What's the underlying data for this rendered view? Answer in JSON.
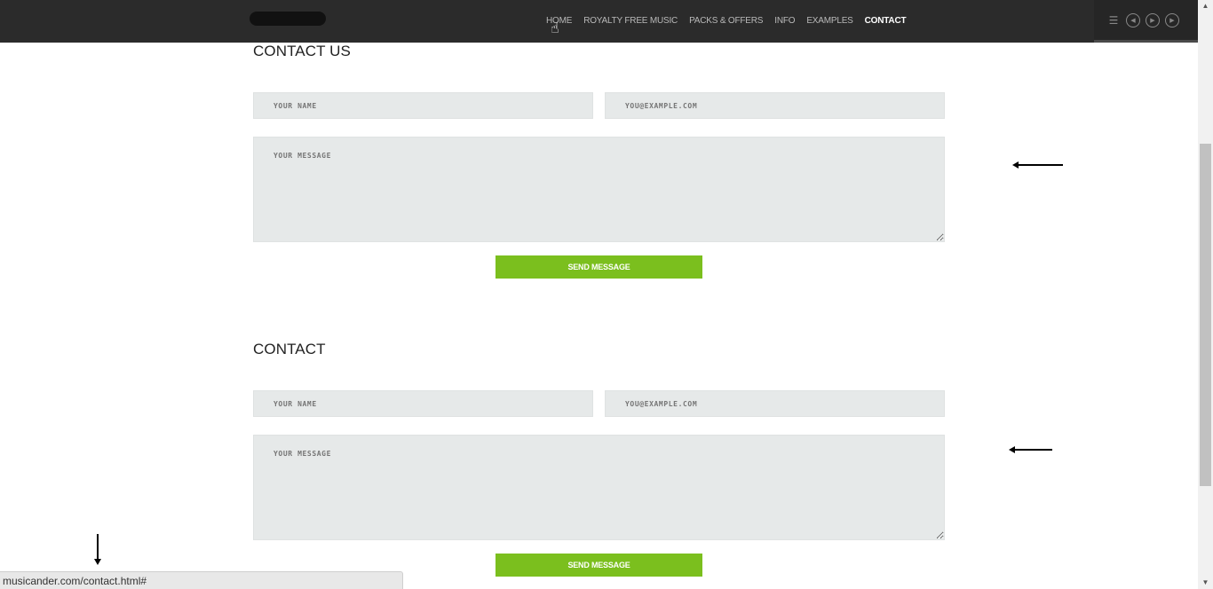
{
  "nav": {
    "items": [
      {
        "label": "HOME",
        "active": false
      },
      {
        "label": "ROYALTY FREE MUSIC",
        "active": false
      },
      {
        "label": "PACKS & OFFERS",
        "active": false
      },
      {
        "label": "INFO",
        "active": false
      },
      {
        "label": "EXAMPLES",
        "active": false
      },
      {
        "label": "CONTACT",
        "active": true
      }
    ]
  },
  "player": {
    "icons": [
      "playlist-icon",
      "previous-icon",
      "play-icon",
      "next-icon"
    ],
    "glyphs": {
      "playlist": "☰",
      "prev": "◀",
      "play": "▶",
      "next": "▶"
    }
  },
  "contact_us": {
    "title": "CONTACT US",
    "name_placeholder": "YOUR NAME",
    "email_placeholder": "YOU@EXAMPLE.COM",
    "message_placeholder": "YOUR MESSAGE",
    "send_label": "SEND MESSAGE"
  },
  "contact": {
    "title": "CONTACT",
    "name_placeholder": "YOUR NAME",
    "email_placeholder": "YOU@EXAMPLE.COM",
    "message_placeholder": "YOUR MESSAGE",
    "send_label": "SEND MESSAGE"
  },
  "status_bar": {
    "url": "musicander.com/contact.html#"
  },
  "colors": {
    "topbar": "#2b2b2b",
    "accent_button": "#7bbf1e",
    "field_bg": "#e6e9e9"
  }
}
